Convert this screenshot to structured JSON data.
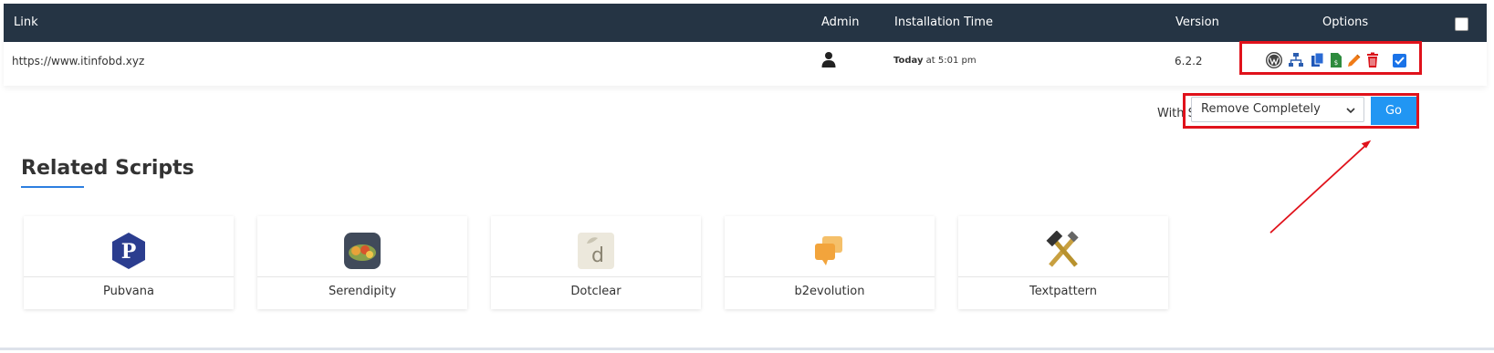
{
  "table": {
    "headers": {
      "link": "Link",
      "admin": "Admin",
      "time": "Installation Time",
      "version": "Version",
      "options": "Options"
    },
    "row": {
      "link": "https://www.itinfobd.xyz",
      "time_bold": "Today",
      "time_rest": " at 5:01 pm",
      "version": "6.2.2",
      "checked": true
    },
    "option_icons": [
      "wordpress-icon",
      "sitemap-icon",
      "copy-icon",
      "backup-file-icon",
      "edit-icon",
      "delete-icon"
    ]
  },
  "bulk": {
    "label": "With Selected:",
    "selected_option": "Remove Completely",
    "go_label": "Go"
  },
  "related": {
    "title": "Related Scripts",
    "scripts": [
      {
        "name": "Pubvana",
        "icon": "pubvana-logo"
      },
      {
        "name": "Serendipity",
        "icon": "serendipity-logo"
      },
      {
        "name": "Dotclear",
        "icon": "dotclear-logo"
      },
      {
        "name": "b2evolution",
        "icon": "b2evolution-logo"
      },
      {
        "name": "Textpattern",
        "icon": "textpattern-logo"
      }
    ]
  },
  "colors": {
    "header_bg": "#253444",
    "accent": "#2196f3",
    "highlight": "#e0121b"
  }
}
